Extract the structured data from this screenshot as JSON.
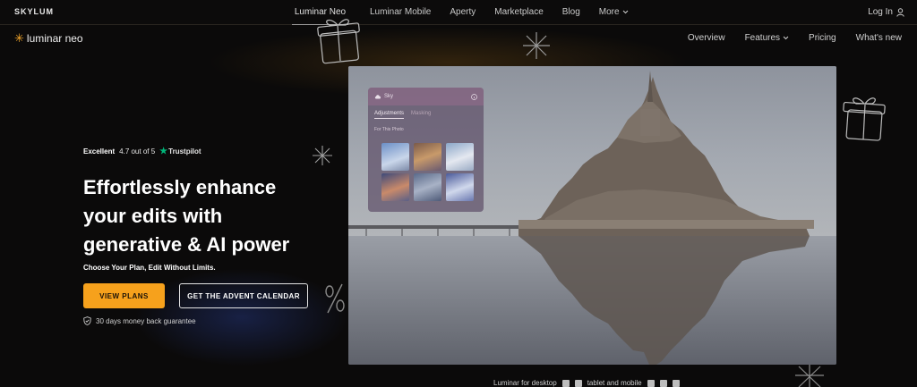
{
  "topbar": {
    "brand": "SKYLUM",
    "nav": [
      "Luminar Neo",
      "Luminar Mobile",
      "Aperty",
      "Marketplace",
      "Blog",
      "More"
    ],
    "login": "Log In"
  },
  "subbar": {
    "logo_text": "luminar neo",
    "nav": [
      "Overview",
      "Features",
      "Pricing",
      "What's new"
    ]
  },
  "hero": {
    "rating": {
      "label": "Excellent",
      "score": "4.7 out of 5",
      "provider": "Trustpilot"
    },
    "headline": [
      "Effortlessly enhance",
      "your edits with",
      "generative & AI power"
    ],
    "tagline": "Choose Your Plan, Edit Without Limits.",
    "btn_plans": "VIEW PLANS",
    "btn_advent": "GET THE ADVENT CALENDAR",
    "guarantee": "30 days money back guarantee"
  },
  "panel": {
    "title": "Sky",
    "tabs": [
      "Adjustments",
      "Masking"
    ],
    "section": "For This Photo"
  },
  "caption": {
    "desktop": "Luminar for desktop",
    "mobile": "tablet and mobile"
  },
  "colors": {
    "accent": "#f6a11c",
    "background": "#0b0a0a",
    "trustpilot": "#00b67a"
  }
}
